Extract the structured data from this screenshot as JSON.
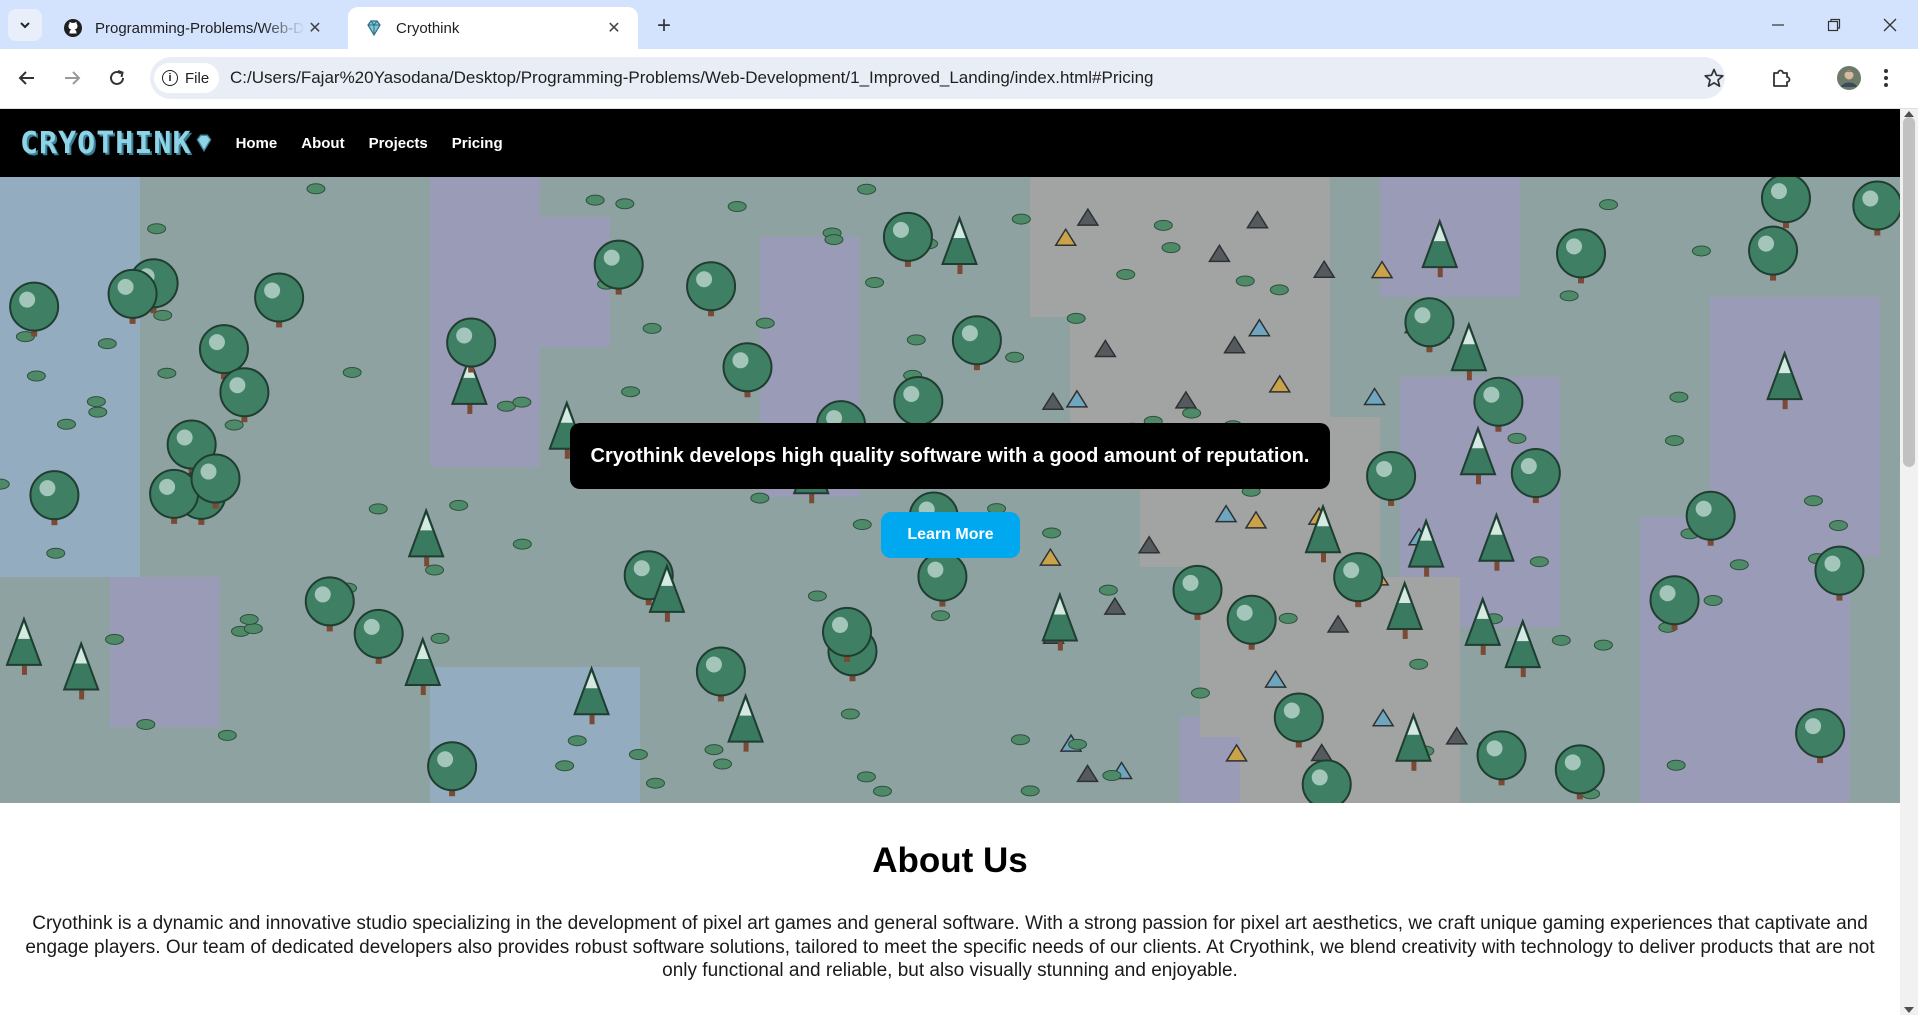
{
  "browser": {
    "tabs": [
      {
        "title": "Programming-Problems/Web-Development",
        "active": false,
        "icon": "github-icon"
      },
      {
        "title": "Cryothink",
        "active": true,
        "icon": "gem-icon"
      }
    ],
    "address": {
      "scheme_label": "File",
      "url": "C:/Users/Fajar%20Yasodana/Desktop/Programming-Problems/Web-Development/1_Improved_Landing/index.html#Pricing"
    }
  },
  "site": {
    "logo_text": "CRYOTHINK",
    "nav": [
      "Home",
      "About",
      "Projects",
      "Pricing"
    ],
    "hero": {
      "headline": "Cryothink develops high quality software with a good amount of reputation.",
      "button": "Learn More"
    },
    "about": {
      "title": "About Us",
      "body": "Cryothink is a dynamic and innovative studio specializing in the development of pixel art games and general software. With a strong passion for pixel art aesthetics, we craft unique gaming experiences that captivate and engage players. Our team of dedicated developers also provides robust software solutions, tailored to meet the specific needs of our clients. At Cryothink, we blend creativity with technology to deliver products that are not only functional and reliable, but also visually stunning and enjoyable."
    }
  },
  "colors": {
    "tabstrip": "#d3e3fd",
    "accent_button": "#00a8f0",
    "nav_bg": "#000000",
    "logo": "#8fd3e6"
  }
}
